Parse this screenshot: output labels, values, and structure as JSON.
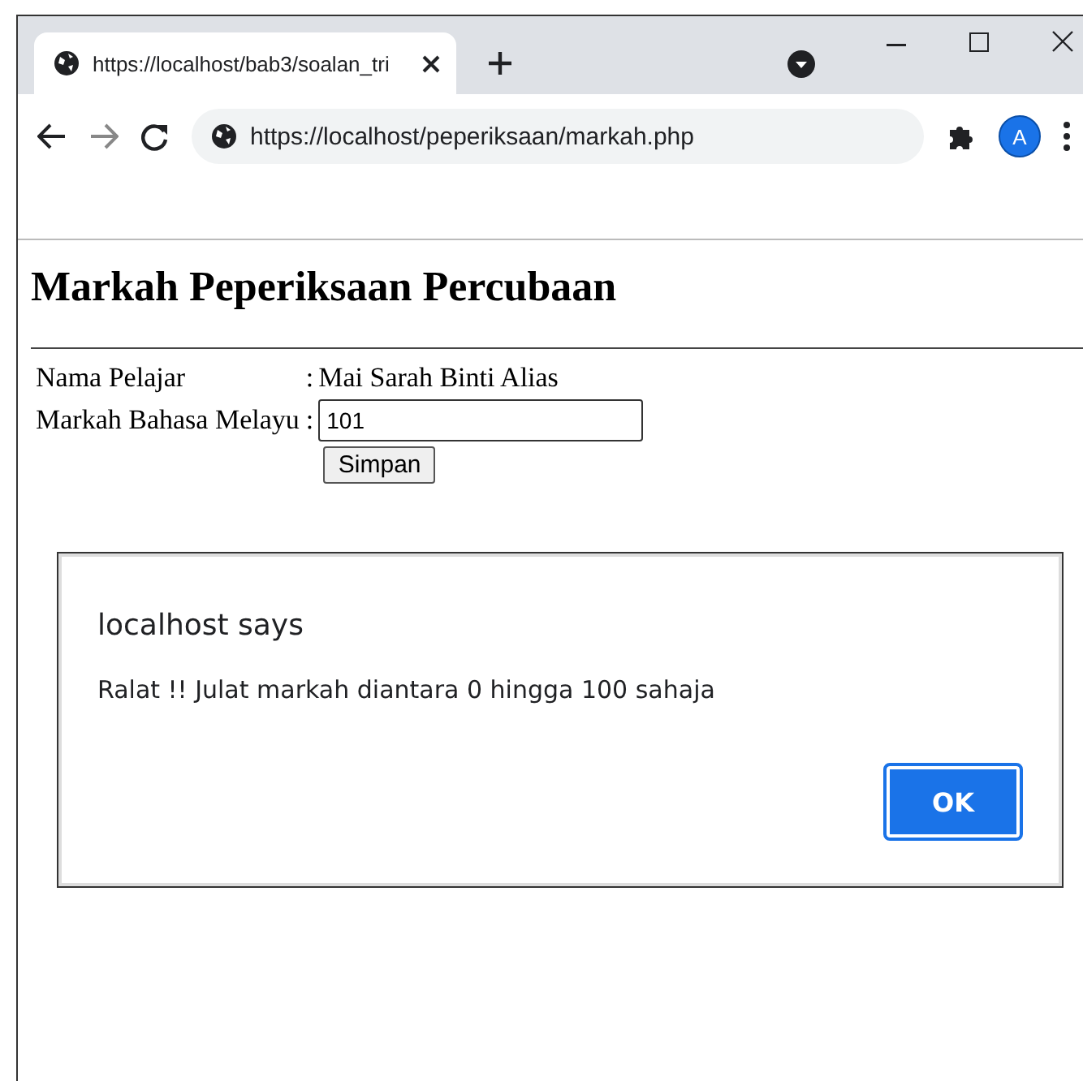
{
  "tabs": [
    {
      "title": "https://localhost/bab3/soalan_tri",
      "selected": true
    }
  ],
  "toolbar": {
    "address": "https://localhost/peperiksaan/markah.php",
    "avatar": "A"
  },
  "page": {
    "heading": "Markah Peperiksaan Percubaan",
    "rows": [
      {
        "kind": "text",
        "label": "Nama Pelajar",
        "separator": ":",
        "value": "Mai Sarah Binti Alias"
      },
      {
        "kind": "input",
        "label": "Markah Bahasa Melayu",
        "separator": ":",
        "value": "101"
      }
    ],
    "button": "Simpan"
  },
  "dialog": {
    "title": "localhost says",
    "message": "Ralat !! Julat markah diantara 0 hingga 100 sahaja",
    "button": "OK"
  }
}
